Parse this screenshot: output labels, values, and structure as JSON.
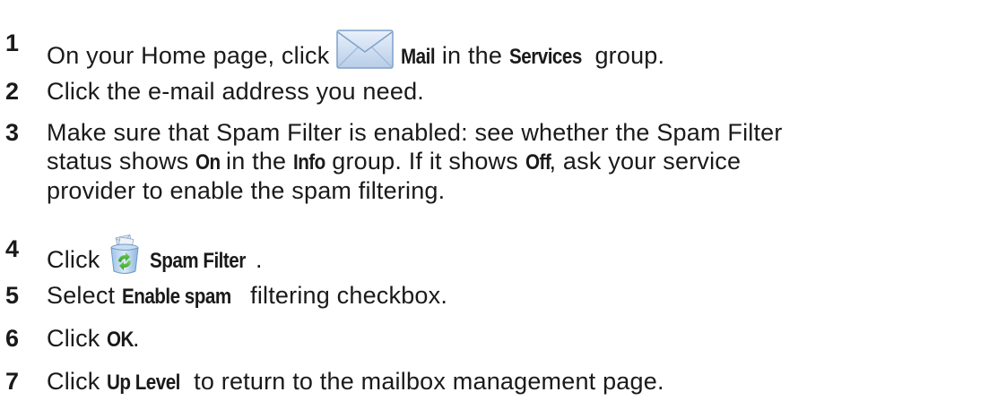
{
  "steps": [
    {
      "number": "1",
      "parts": {
        "a": "On your Home page, click ",
        "icon": "envelope-icon",
        "b": "Mail",
        "c": " in the ",
        "d": "Services",
        "e": " group."
      }
    },
    {
      "number": "2",
      "parts": {
        "a": "Click the e-mail address you need."
      }
    },
    {
      "number": "3",
      "lines": [
        {
          "a": "Make sure that Spam Filter is enabled: see whether the Spam Filter"
        },
        {
          "a": "status shows ",
          "b": "On",
          "c": " in the ",
          "d": "Info",
          "e": " group. If it shows ",
          "f": "Off",
          "g": ", ask your service"
        },
        {
          "a": "provider to enable the spam filtering."
        }
      ]
    },
    {
      "number": "4",
      "parts": {
        "a": "Click ",
        "icon": "recycle-bin-icon",
        "b": "Spam Filter",
        "c": "."
      }
    },
    {
      "number": "5",
      "parts": {
        "a": "Select ",
        "b": "Enable spam",
        "c": " filtering checkbox."
      }
    },
    {
      "number": "6",
      "parts": {
        "a": "Click ",
        "b": "OK",
        "c": "."
      }
    },
    {
      "number": "7",
      "parts": {
        "a": "Click ",
        "b": "Up Level",
        "c": " to return to the mailbox management page."
      }
    }
  ]
}
